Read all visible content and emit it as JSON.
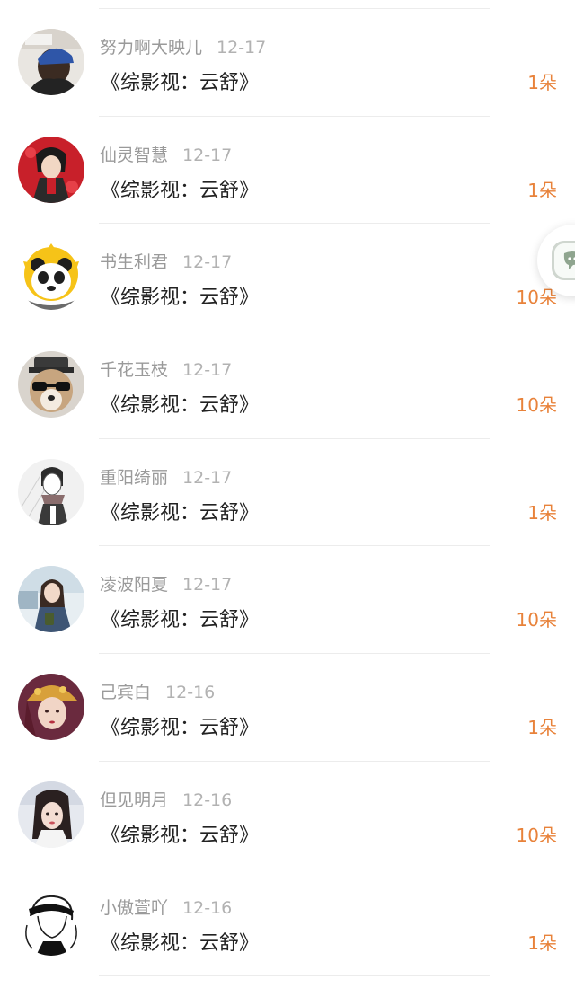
{
  "items": [
    {
      "user": "努力啊大映儿",
      "date": "12-17",
      "title": "《综影视：云舒》",
      "amount": "1朵",
      "avatar": "user-photo-blue-cap"
    },
    {
      "user": "仙灵智慧",
      "date": "12-17",
      "title": "《综影视：云舒》",
      "amount": "1朵",
      "avatar": "anime-character-red"
    },
    {
      "user": "书生利君",
      "date": "12-17",
      "title": "《综影视：云舒》",
      "amount": "10朵",
      "avatar": "panda-sun-cartoon"
    },
    {
      "user": "千花玉枝",
      "date": "12-17",
      "title": "《综影视：云舒》",
      "amount": "10朵",
      "avatar": "dog-with-glasses"
    },
    {
      "user": "重阳绮丽",
      "date": "12-17",
      "title": "《综影视：云舒》",
      "amount": "1朵",
      "avatar": "sketch-boy-scarf"
    },
    {
      "user": "凌波阳夏",
      "date": "12-17",
      "title": "《综影视：云舒》",
      "amount": "10朵",
      "avatar": "girl-with-phone"
    },
    {
      "user": "己宾白",
      "date": "12-16",
      "title": "《综影视：云舒》",
      "amount": "1朵",
      "avatar": "costume-lady-headdress"
    },
    {
      "user": "但见明月",
      "date": "12-16",
      "title": "《综影视：云舒》",
      "amount": "10朵",
      "avatar": "portrait-girl-dark-hair"
    },
    {
      "user": "小傲萱吖",
      "date": "12-16",
      "title": "《综影视：云舒》",
      "amount": "1朵",
      "avatar": "line-art-girl-headband"
    }
  ],
  "floating_button": {
    "icon": "chat-bubble-icon"
  },
  "colors": {
    "amount": "#e8823a",
    "username": "#9a9a9a",
    "title": "#222222",
    "divider": "#ececec"
  }
}
